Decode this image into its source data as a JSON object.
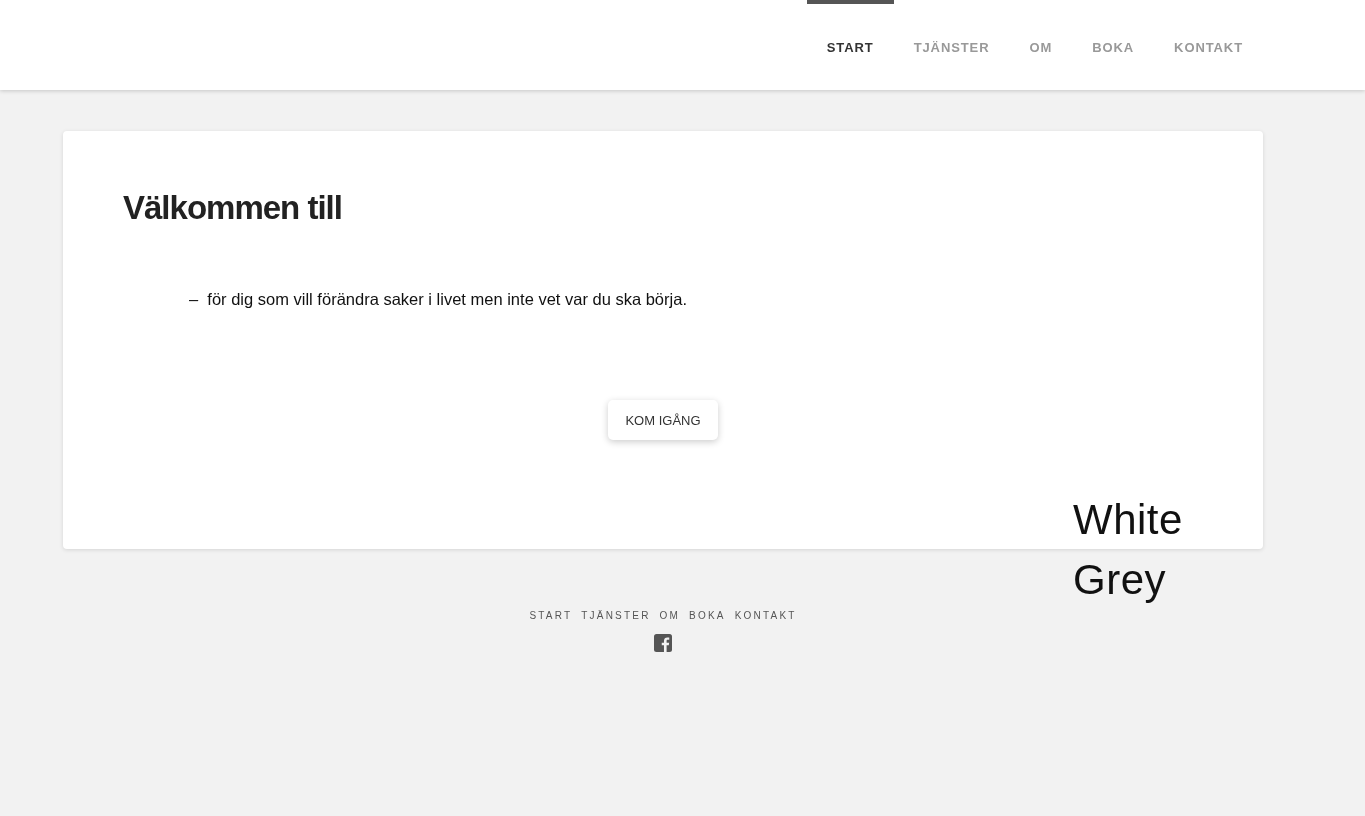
{
  "header": {
    "nav": [
      {
        "label": "START",
        "selected": true
      },
      {
        "label": "TJÄNSTER",
        "selected": false
      },
      {
        "label": "OM",
        "selected": false
      },
      {
        "label": "BOKA",
        "selected": false
      },
      {
        "label": "KONTAKT",
        "selected": false
      }
    ]
  },
  "card": {
    "heading": "Välkommen till",
    "text": "–  för dig som vill förändra saker i livet men inte vet var du ska börja.",
    "button": "KOM IGÅNG"
  },
  "footer": {
    "links": [
      "START",
      "TJÄNSTER",
      "OM",
      "BOKA",
      "KONTAKT"
    ]
  },
  "theme_label": "White Grey"
}
